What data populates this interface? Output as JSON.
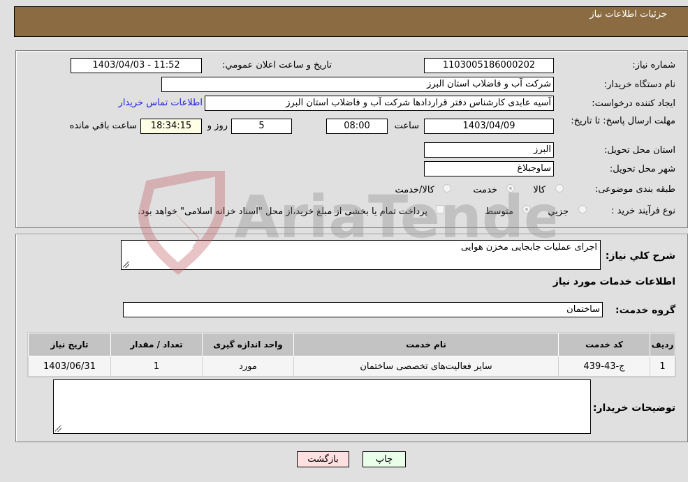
{
  "header": {
    "title": "جزئیات اطلاعات نیاز"
  },
  "form": {
    "need_number": {
      "label": "شماره نیاز:",
      "value": "1103005186000202"
    },
    "announce_datetime": {
      "label": "تاریخ و ساعت اعلان عمومي:",
      "value": "1403/04/03 - 11:52"
    },
    "buyer_org": {
      "label": "نام دستگاه خريدار:",
      "value": "شرکت آب و فاضلاب استان البرز"
    },
    "requester": {
      "label": "ايجاد کننده درخواست:",
      "value": "آسیه عابدی کارشناس دفتر قراردادها شرکت آب و فاضلاب استان البرز"
    },
    "buyer_contact_link": "اطلاعات تماس خريدار",
    "deadline": {
      "label": "مهلت ارسال پاسخ: تا تاریخ:",
      "date": "1403/04/09",
      "time_label": "ساعت",
      "time": "08:00",
      "days": "5",
      "days_label": "روز و",
      "remaining": "18:34:15",
      "remaining_label": "ساعت باقي مانده"
    },
    "province": {
      "label": "استان محل تحویل:",
      "value": "البرز"
    },
    "city": {
      "label": "شهر محل تحویل:",
      "value": "ساوجبلاغ"
    },
    "category": {
      "label": "طبقه بندی موضوعی:",
      "options": [
        {
          "label": "کالا",
          "checked": false
        },
        {
          "label": "خدمت",
          "checked": true
        },
        {
          "label": "کالا/خدمت",
          "checked": false
        }
      ]
    },
    "purchase_type": {
      "label": "نوع فرآيند خريد :",
      "options": [
        {
          "label": "جزيي",
          "checked": false
        },
        {
          "label": "متوسط",
          "checked": true
        }
      ],
      "treasury_note": "پرداخت تمام یا بخشی از مبلغ خرید،از محل \"اسناد خزانه اسلامی\" خواهد بود."
    }
  },
  "details": {
    "description_label": "شرح کلي نياز:",
    "description": "اجرای عملیات جابجایی مخزن هوایی",
    "services_title": "اطلاعات خدمات مورد نیاز",
    "service_group_label": "گروه خدمت:",
    "service_group": "ساختمان",
    "table": {
      "headers": [
        "رديف",
        "کد خدمت",
        "نام خدمت",
        "واحد اندازه گیری",
        "تعداد / مقدار",
        "تاریخ نیاز"
      ],
      "rows": [
        [
          "1",
          "ج-43-439",
          "سایر فعالیت‌های تخصصی ساختمان",
          "مورد",
          "1",
          "1403/06/31"
        ]
      ]
    },
    "buyer_notes_label": "توضیحات خریدار:",
    "buyer_notes": ""
  },
  "buttons": {
    "print": "چاپ",
    "back": "بازگشت"
  },
  "watermark": {
    "text": "AriaTender.neT"
  },
  "colors": {
    "header_bg": "#8b6c42",
    "link": "#2222dd",
    "back_btn": "#ffe0e0",
    "print_btn": "#eaffea"
  }
}
